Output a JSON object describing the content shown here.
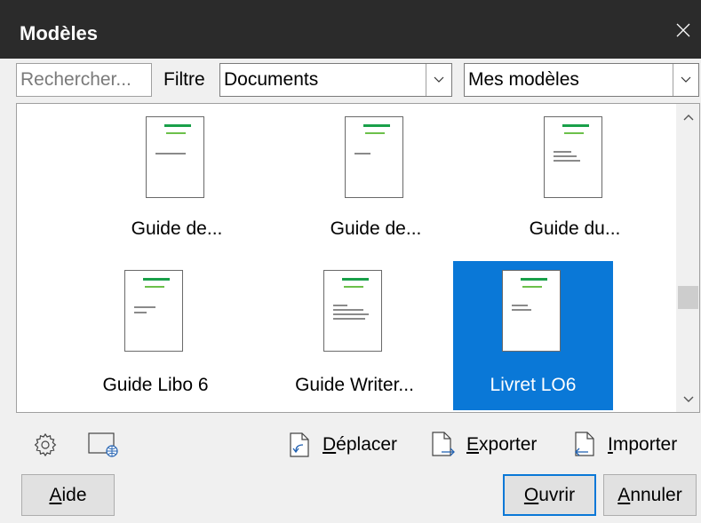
{
  "dialog": {
    "title": "Modèles"
  },
  "search": {
    "placeholder": "Rechercher..."
  },
  "filter": {
    "label": "Filtre",
    "document_type": "Documents",
    "category": "Mes modèles"
  },
  "templates": [
    {
      "label": "Guide de...",
      "selected": false
    },
    {
      "label": "Guide de...",
      "selected": false
    },
    {
      "label": "Guide du...",
      "selected": false
    },
    {
      "label": "Guide Libo 6",
      "selected": false
    },
    {
      "label": "Guide Writer...",
      "selected": false
    },
    {
      "label": "Livret LO6",
      "selected": true
    }
  ],
  "toolbar": {
    "settings_icon": "gear-icon",
    "online_icon": "globe-document-icon",
    "move": {
      "prefix": "",
      "accel": "D",
      "rest": "éplacer"
    },
    "export": {
      "prefix": "",
      "accel": "E",
      "rest": "xporter"
    },
    "import": {
      "prefix": "",
      "accel": "I",
      "rest": "mporter"
    }
  },
  "buttons": {
    "help": {
      "accel": "A",
      "rest": "ide"
    },
    "open": {
      "accel": "O",
      "rest": "uvrir"
    },
    "cancel": {
      "accel": "A",
      "rest": "nnuler"
    }
  },
  "colors": {
    "title_bar": "#2b2b2b",
    "selection": "#0a78d7",
    "dialog_bg": "#f0f0f0"
  }
}
